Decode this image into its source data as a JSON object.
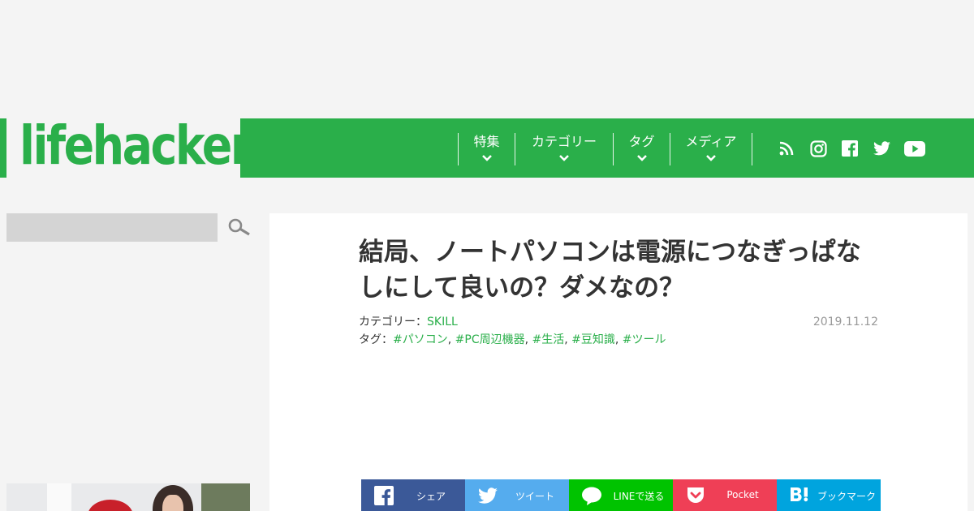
{
  "brand": {
    "logo_text": "lifehacker",
    "accent": "#2aaf4a"
  },
  "nav": {
    "items": [
      {
        "label": "特集"
      },
      {
        "label": "カテゴリー"
      },
      {
        "label": "タグ"
      },
      {
        "label": "メディア"
      }
    ]
  },
  "social": [
    "rss-icon",
    "instagram-icon",
    "facebook-icon",
    "twitter-icon",
    "youtube-icon"
  ],
  "article": {
    "title": "結局、ノートパソコンは電源につなぎっぱなしにして良いの？ダメなの？",
    "category_label": "カテゴリー：",
    "category": "SKILL",
    "date": "2019.11.12",
    "tags_label": "タグ：",
    "tags": [
      "#パソコン",
      "#PC周辺機器",
      "#生活",
      "#豆知識",
      "#ツール"
    ],
    "tag_separator": ", "
  },
  "share": {
    "facebook": {
      "label": "シェア",
      "color": "#3b5998"
    },
    "twitter": {
      "label": "ツイート",
      "color": "#55acee"
    },
    "line": {
      "label": "LINEで送る",
      "color": "#00c300"
    },
    "pocket": {
      "label": "Pocket",
      "color": "#ef3f56"
    },
    "hatena": {
      "label": "ブックマーク",
      "color": "#00a4de"
    }
  }
}
